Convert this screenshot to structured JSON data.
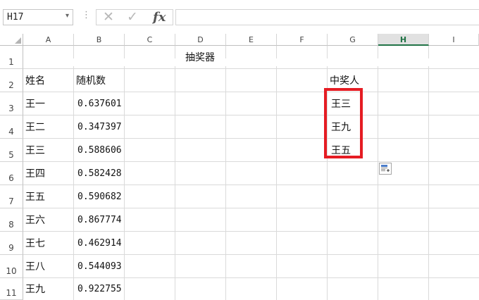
{
  "formula_bar": {
    "name_box": "H17",
    "dropdown_glyph": "▾",
    "separator_glyph": "⋮",
    "cancel_glyph": "✕",
    "enter_glyph": "✓",
    "fx_label": "fx",
    "formula_value": ""
  },
  "columns": [
    "A",
    "B",
    "C",
    "D",
    "E",
    "F",
    "G",
    "H",
    "I"
  ],
  "selected_column": "H",
  "rows": [
    "1",
    "2",
    "3",
    "4",
    "5",
    "6",
    "7",
    "8",
    "9",
    "10",
    "11"
  ],
  "sheet": {
    "title": "抽奖器",
    "header_name": "姓名",
    "header_random": "随机数",
    "header_winner": "中奖人",
    "data": [
      {
        "name": "王一",
        "value": "0.637601"
      },
      {
        "name": "王二",
        "value": "0.347397"
      },
      {
        "name": "王三",
        "value": "0.588606"
      },
      {
        "name": "王四",
        "value": "0.582428"
      },
      {
        "name": "王五",
        "value": "0.590682"
      },
      {
        "name": "王六",
        "value": "0.867774"
      },
      {
        "name": "王七",
        "value": "0.462914"
      },
      {
        "name": "王八",
        "value": "0.544093"
      },
      {
        "name": "王九",
        "value": "0.922755"
      }
    ],
    "winners": [
      "王三",
      "王九",
      "王五"
    ]
  },
  "colors": {
    "highlight": "#e51c23",
    "selected_column_accent": "#217346"
  },
  "icons": {
    "paste_options": "paste-options-icon"
  }
}
